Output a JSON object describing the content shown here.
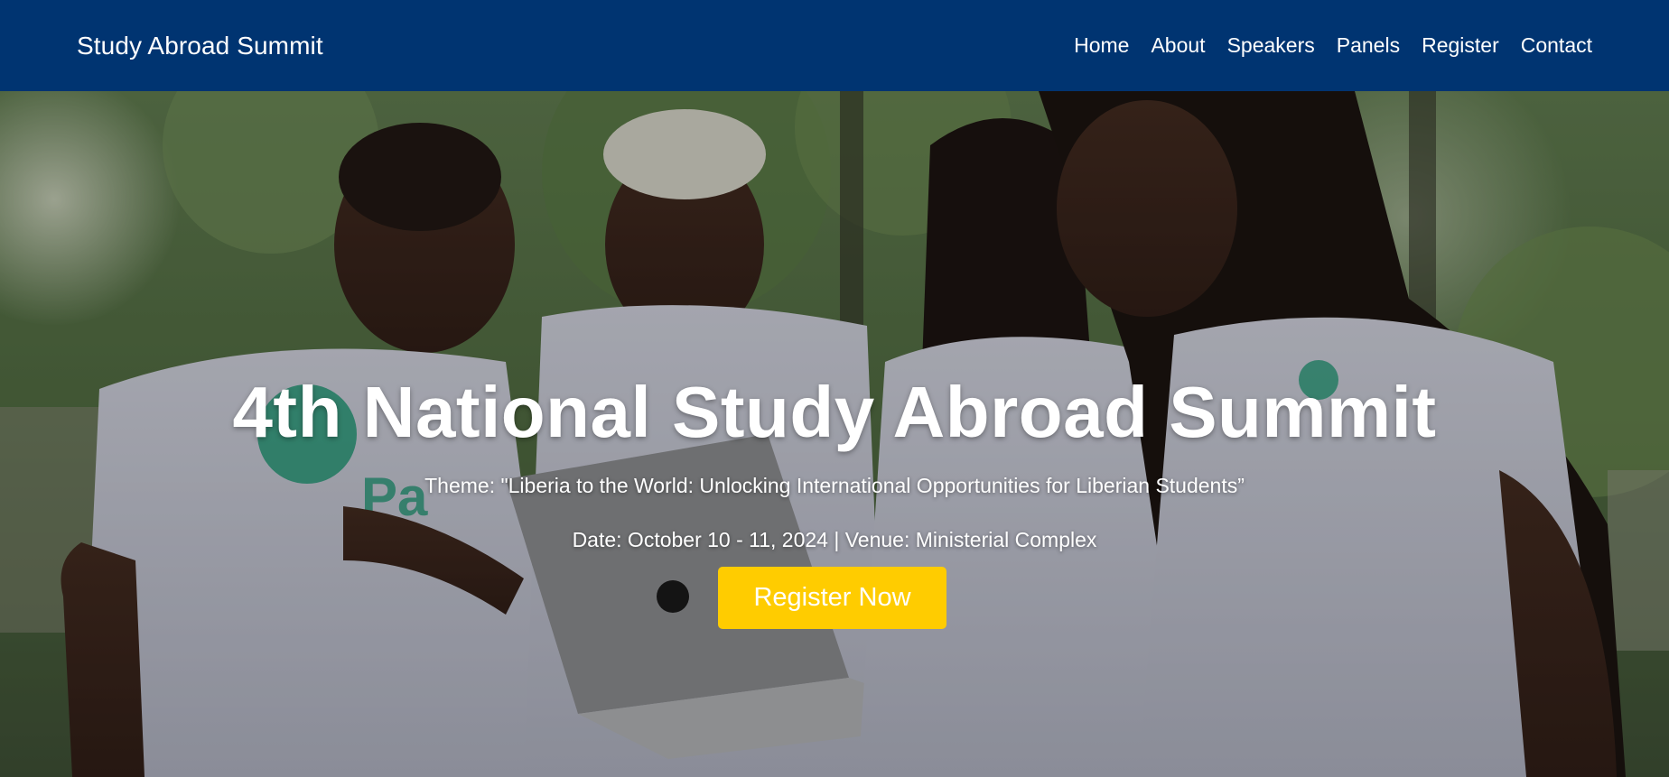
{
  "header": {
    "brand": "Study Abroad Summit",
    "nav": [
      {
        "label": "Home"
      },
      {
        "label": "About"
      },
      {
        "label": "Speakers"
      },
      {
        "label": "Panels"
      },
      {
        "label": "Register"
      },
      {
        "label": "Contact"
      }
    ]
  },
  "hero": {
    "title": "4th National Study Abroad Summit",
    "theme": "Theme: \"Liberia to the World: Unlocking International Opportunities for Liberian Students”",
    "date_venue": "Date: October 10 - 11, 2024 | Venue: Ministerial Complex",
    "cta_label": "Register Now",
    "image_subject": "students-with-laptop-photo"
  },
  "colors": {
    "nav_bg": "#003471",
    "cta_bg": "#ffcc00",
    "text": "#ffffff"
  }
}
